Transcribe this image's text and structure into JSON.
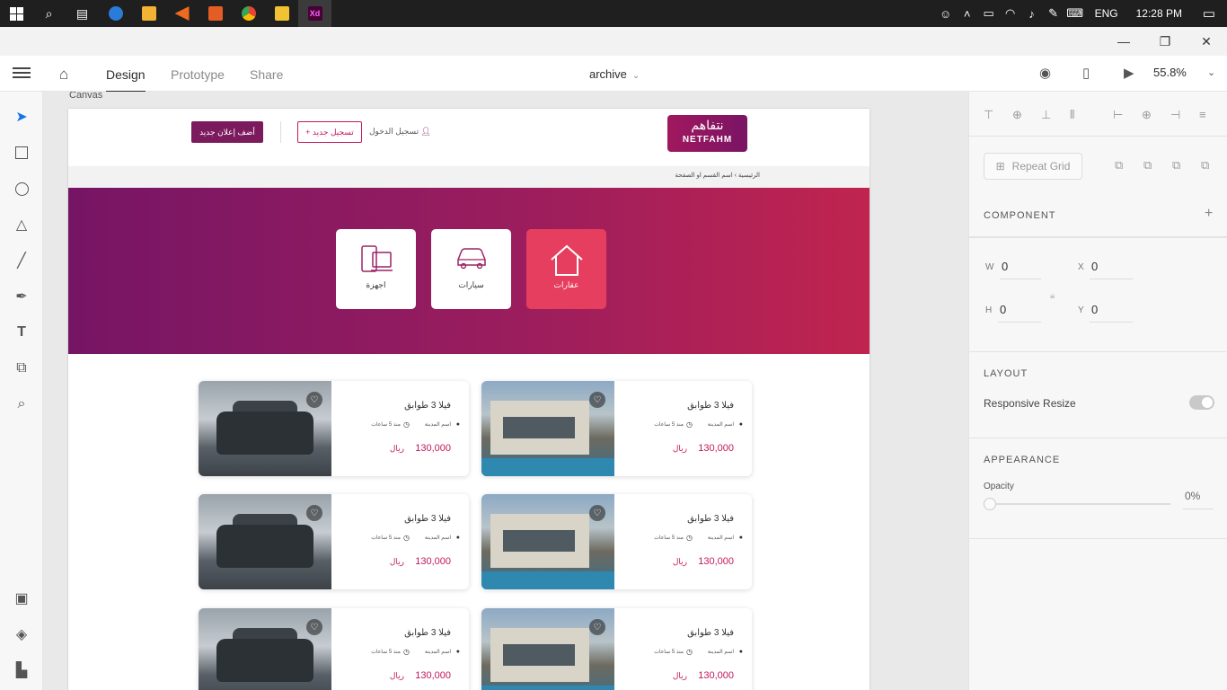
{
  "taskbar": {
    "start_icon": "windows-logo-icon",
    "apps": [
      {
        "name": "search-icon"
      },
      {
        "name": "task-view-icon"
      },
      {
        "name": "edge-icon",
        "color": "#2b7bd8"
      },
      {
        "name": "store-icon",
        "color": "#f2b233"
      },
      {
        "name": "media-player-icon",
        "color": "#ee6a20"
      },
      {
        "name": "app-icon",
        "color": "#e45d24"
      },
      {
        "name": "chrome-icon",
        "color": "#34a853"
      },
      {
        "name": "file-explorer-icon",
        "color": "#f1c232"
      },
      {
        "name": "adobe-xd-icon",
        "color": "#470137"
      }
    ],
    "lang": "ENG",
    "time": "12:28 PM"
  },
  "toolbar": {
    "tabs": [
      "Design",
      "Prototype",
      "Share"
    ],
    "active_tab": "Design",
    "doc_title": "archive",
    "zoom": "55.8%"
  },
  "canvas": {
    "label": "Canvas"
  },
  "site": {
    "logo_ar": "نتفاهم",
    "logo_en": "NETFAHM",
    "add_button": "أضف إعلان جديد",
    "register_button": "+ تسجيل جديد",
    "login": "تسجيل الدخول",
    "breadcrumb": "الرئيسية  ›  اسم القسم او الصفحة",
    "brand_color": "#7c1a5e",
    "accent_color": "#c2185b",
    "categories": [
      {
        "label": "اجهزة",
        "icon": "devices-icon",
        "active": false
      },
      {
        "label": "سيارات",
        "icon": "car-icon",
        "active": false
      },
      {
        "label": "عقارات",
        "icon": "house-icon",
        "active": true
      }
    ],
    "cards": [
      {
        "type": "car",
        "title": "فيلا 3 طوابق",
        "city": "اسم المدينة",
        "time": "منذ 5 ساعات",
        "price": "130,000",
        "currency": "ريال"
      },
      {
        "type": "house",
        "title": "فيلا 3 طوابق",
        "city": "اسم المدينة",
        "time": "منذ 5 ساعات",
        "price": "130,000",
        "currency": "ريال"
      },
      {
        "type": "car",
        "title": "فيلا 3 طوابق",
        "city": "اسم المدينة",
        "time": "منذ 5 ساعات",
        "price": "130,000",
        "currency": "ريال"
      },
      {
        "type": "house",
        "title": "فيلا 3 طوابق",
        "city": "اسم المدينة",
        "time": "منذ 5 ساعات",
        "price": "130,000",
        "currency": "ريال"
      },
      {
        "type": "car",
        "title": "فيلا 3 طوابق",
        "city": "اسم المدينة",
        "time": "منذ 5 ساعات",
        "price": "130,000",
        "currency": "ريال"
      },
      {
        "type": "house",
        "title": "فيلا 3 طوابق",
        "city": "اسم المدينة",
        "time": "منذ 5 ساعات",
        "price": "130,000",
        "currency": "ريال"
      }
    ]
  },
  "panel": {
    "repeat_grid": "Repeat Grid",
    "component": "COMPONENT",
    "w_label": "W",
    "w_value": "0",
    "h_label": "H",
    "h_value": "0",
    "x_label": "X",
    "x_value": "0",
    "y_label": "Y",
    "y_value": "0",
    "layout": "LAYOUT",
    "responsive_resize": "Responsive Resize",
    "appearance": "APPEARANCE",
    "opacity_label": "Opacity",
    "opacity_value": "0%"
  }
}
